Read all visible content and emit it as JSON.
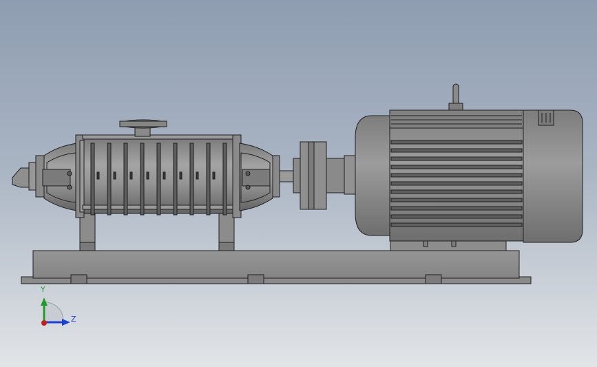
{
  "scene": {
    "description_visible": false,
    "model_parts": [
      "multistage-pump",
      "flexible-coupling",
      "electric-motor",
      "base-frame"
    ]
  },
  "motor": {
    "nameplate_text": "",
    "fin_count": 11
  },
  "pump": {
    "stage_count": 9
  },
  "triad": {
    "y_label": "Y",
    "z_label": "Z",
    "colors": {
      "y": "#1e9b2a",
      "z": "#1a3fd6",
      "x": "#c41e1e"
    }
  },
  "colors": {
    "metal": "#8f8f8f",
    "metal_dark": "#6d6d6d",
    "metal_light": "#a9a9a9",
    "outline": "#1f1f1f"
  }
}
